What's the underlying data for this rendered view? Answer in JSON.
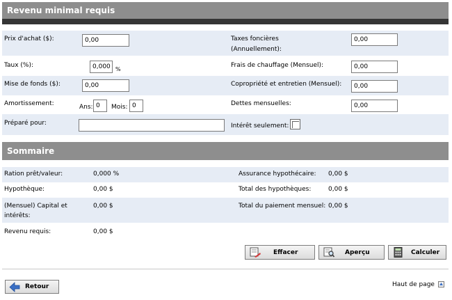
{
  "header": {
    "title": "Revenu minimal requis"
  },
  "form": {
    "prix_achat": {
      "label": "Prix d'achat ($):",
      "value": "0,00"
    },
    "taux": {
      "label": "Taux (%):",
      "value": "0,000",
      "suffix": "%"
    },
    "mise_de_fonds": {
      "label": "Mise de fonds ($):",
      "value": "0,00"
    },
    "amortissement": {
      "label": "Amortissement:",
      "ans_label": "Ans:",
      "ans_value": "0",
      "mois_label": "Mois:",
      "mois_value": "0"
    },
    "prepare_pour": {
      "label": "Préparé pour:",
      "value": ""
    },
    "taxes_foncieres": {
      "label_line1": "Taxes foncières",
      "label_line2": "(Annuellement):",
      "value": "0,00"
    },
    "frais_chauffage": {
      "label": "Frais de chauffage (Mensuel):",
      "value": "0,00"
    },
    "copropriete": {
      "label": "Copropriété et entretien (Mensuel):",
      "value": "0,00"
    },
    "dettes_mensuelles": {
      "label": "Dettes mensuelles:",
      "value": "0,00"
    },
    "interet_seulement": {
      "label": "Intérêt seulement:",
      "checked": false
    }
  },
  "summary": {
    "title": "Sommaire",
    "ratio": {
      "label": "Ration prêt/valeur:",
      "value": "0,000 %"
    },
    "hypotheque": {
      "label": "Hypothèque:",
      "value": "0,00 $"
    },
    "capital_interets": {
      "label_line1": "(Mensuel) Capital et",
      "label_line2": "intérêts:",
      "value": "0,00 $"
    },
    "revenu_requis": {
      "label": "Revenu requis:",
      "value": "0,00 $"
    },
    "assurance": {
      "label": "Assurance hypothécaire:",
      "value": "0,00 $"
    },
    "total_hypotheques": {
      "label": "Total des hypothèques:",
      "value": "0,00 $"
    },
    "total_paiement": {
      "label": "Total du paiement mensuel:",
      "value": "0,00 $"
    }
  },
  "buttons": {
    "effacer": "Effacer",
    "apercu": "Aperçu",
    "calculer": "Calculer",
    "retour": "Retour"
  },
  "footer": {
    "haut_de_page": "Haut de page"
  },
  "colors": {
    "header_gray": "#8e8e8e",
    "dark_bar": "#353535",
    "row_shade": "#e6ecf5",
    "arrow_blue": "#3a6fc4"
  }
}
